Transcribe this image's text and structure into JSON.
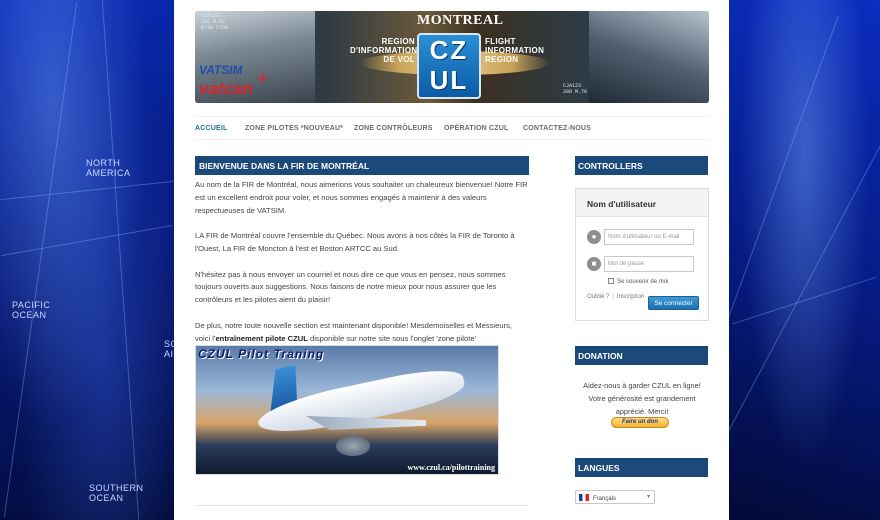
{
  "background": {
    "labels": [
      {
        "id": "north-america",
        "lines": [
          "NORTH",
          "AMERICA"
        ]
      },
      {
        "id": "pacific-ocean",
        "lines": [
          "PACIFIC",
          "OCEAN"
        ]
      },
      {
        "id": "southern-ocean",
        "lines": [
          "SOUTHERN",
          "OCEAN"
        ]
      },
      {
        "id": "fragment",
        "lines": [
          "SO",
          "AI"
        ]
      }
    ]
  },
  "header": {
    "city": "MONTREAL",
    "badge_top": "CZ",
    "badge_bottom": "UL",
    "left_lines": [
      "REGION",
      "D'INFORMATION",
      "DE VOL"
    ],
    "right_lines": [
      "FLIGHT",
      "INFORMATION",
      "REGION"
    ],
    "vatsim": "VATSIM",
    "vatcan": "vatcan",
    "readout_1": [
      "CJA123",
      "350 M.82",
      "B738 CYOW"
    ],
    "readout_2": [
      "CJA123",
      "280 M.78"
    ]
  },
  "nav": {
    "items": [
      {
        "label": "ACCUEIL",
        "active": true
      },
      {
        "label": "ZONE PILOTES *NOUVEAU*",
        "active": false
      },
      {
        "label": "ZONE CONTRÔLEURS",
        "active": false
      },
      {
        "label": "OPÉRATION CZUL",
        "active": false
      },
      {
        "label": "CONTACTEZ-NOUS",
        "active": false
      }
    ]
  },
  "post": {
    "title": "BIENVENUE DANS LA FIR DE MONTRÉAL",
    "p1": "Au nom de la FIR de Montréal, nous aimerions vous souhaiter un chaleureux bienvenue! Notre FIR est un excellent endroit pour voler, et nous sommes engagés à maintenir à des valeurs respectueuses de VATSIM.",
    "p2": "LA FIR de Montréal couvre l'ensemble du Québec. Nous avons à nos côtés la FIR de Toronto à l'Ouest, La FIR de Moncton à l'est et Boston ARTCC au Sud.",
    "p3": "N'hésitez pas à nous envoyer un courriel et nous dire ce que vous en pensez, nous sommes toujours ouverts aux suggestions. Nous faisons de notre mieux pour nous assurer que les contrôleurs et les pilotes aient du plaisir!",
    "p4_start": "De plus, notre toute nouvelle section est maintenant disponible! Mesdemoiselles et Messieurs, voici l'",
    "p4_strong": "entraînement pilote CZUL",
    "p4_end": " disponible sur notre site sous l'onglet 'zone pilote'",
    "image_title": "CZUL Pilot Traning",
    "image_url": "www.czul.ca/pilottraining",
    "image_tail_text": "CZ UL"
  },
  "sidebar": {
    "controllers_title": "CONTROLLERS",
    "login": {
      "heading": "Nom d'utilisateur",
      "username_placeholder": "Nom d'utilisateur ou E-mail",
      "password_placeholder": "Mot de passe",
      "remember": "Se souvenir de moi",
      "forgot": "Oublié ?",
      "register": "Inscription",
      "submit": "Se connecter"
    },
    "donation_title": "DONATION",
    "donation_text": "Aidez-nous à garder CZUL en ligne! Votre générosité est grandement apprécié. Merci!",
    "donate_button": "Faire un don",
    "languages_title": "LANGUES",
    "language_selected": "Français"
  },
  "colors": {
    "accent": "#1b4a7a",
    "nav_active": "#21759b",
    "button": "#2a82c4"
  }
}
